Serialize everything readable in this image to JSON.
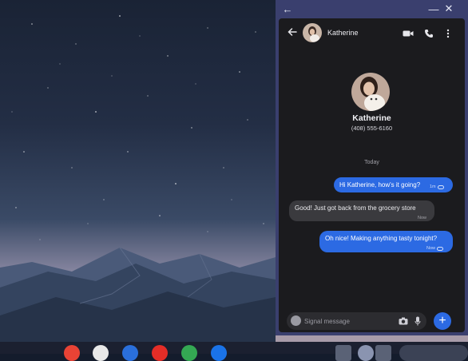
{
  "window": {
    "back_glyph": "←",
    "minimize_glyph": "—",
    "close_glyph": "✕"
  },
  "conversation": {
    "contact_name": "Katherine",
    "contact_phone": "(408) 555-6160",
    "date_divider": "Today",
    "messages": [
      {
        "direction": "out",
        "text": "Hi Katherine, how's it going?",
        "time": "1m"
      },
      {
        "direction": "in",
        "text": "Good! Just got back from the grocery store",
        "time": "Now"
      },
      {
        "direction": "out",
        "text": "Oh nice! Making anything tasty tonight?",
        "time": "Now"
      }
    ]
  },
  "composer": {
    "placeholder": "Signal message",
    "send_glyph": "+"
  },
  "icons": {
    "back": "arrow-left-icon",
    "video": "video-call-icon",
    "phone": "phone-icon",
    "more": "more-vert-icon",
    "emoji": "emoji-icon",
    "camera": "camera-icon",
    "mic": "microphone-icon"
  },
  "colors": {
    "window_frame": "#3a3f6e",
    "app_background": "#1b1b1e",
    "outgoing_bubble": "#2c6ae3",
    "incoming_bubble": "#3a3a3e",
    "shelf": "#1b2030"
  }
}
